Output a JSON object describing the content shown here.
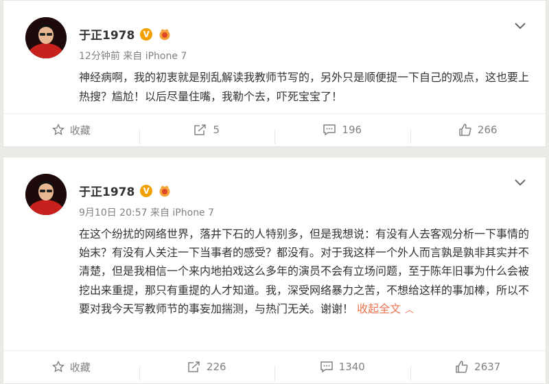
{
  "posts": [
    {
      "author": "于正1978",
      "verified_badge": "V",
      "meta": "12分钟前 来自 iPhone 7",
      "content": "神经病啊，我的初衷就是别乱解读我教师节写的，另外只是顺便提一下自己的观点，这也要上热搜？尴尬！以后尽量住嘴，我勒个去，吓死宝宝了！",
      "collapse_label": "",
      "actions": {
        "favorite": "收藏",
        "repost": "5",
        "comment": "196",
        "like": "266"
      }
    },
    {
      "author": "于正1978",
      "verified_badge": "V",
      "meta": "9月10日 20:57 来自 iPhone 7",
      "content": "在这个纷扰的网络世界，落井下石的人特别多，但是我想说：有没有人去客观分析一下事情的始末？有没有人关注一下当事者的感受？都没有。对于我这样一个外人而言孰是孰非其实并不清楚，但是我相信一个来内地拍戏这么多年的演员不会有立场问题，至于陈年旧事为什么会被挖出来重提，那只有重提的人才知道。我，深受网络暴力之苦，不想给这样的事加棒，所以不要对我今天写教师节的事妄加揣测，与热门无关。谢谢！",
      "collapse_label": "收起全文",
      "actions": {
        "favorite": "收藏",
        "repost": "226",
        "comment": "1340",
        "like": "2637"
      }
    }
  ],
  "icons": {
    "vip": "vip-crown-icon",
    "expand": "chevron-down-icon",
    "favorite": "star-icon",
    "repost": "repost-icon",
    "comment": "comment-icon",
    "like": "thumbs-up-icon"
  },
  "colors": {
    "link": "#eb7350",
    "verified": "#f3a100",
    "meta": "#808080",
    "background": "#eceae6"
  }
}
